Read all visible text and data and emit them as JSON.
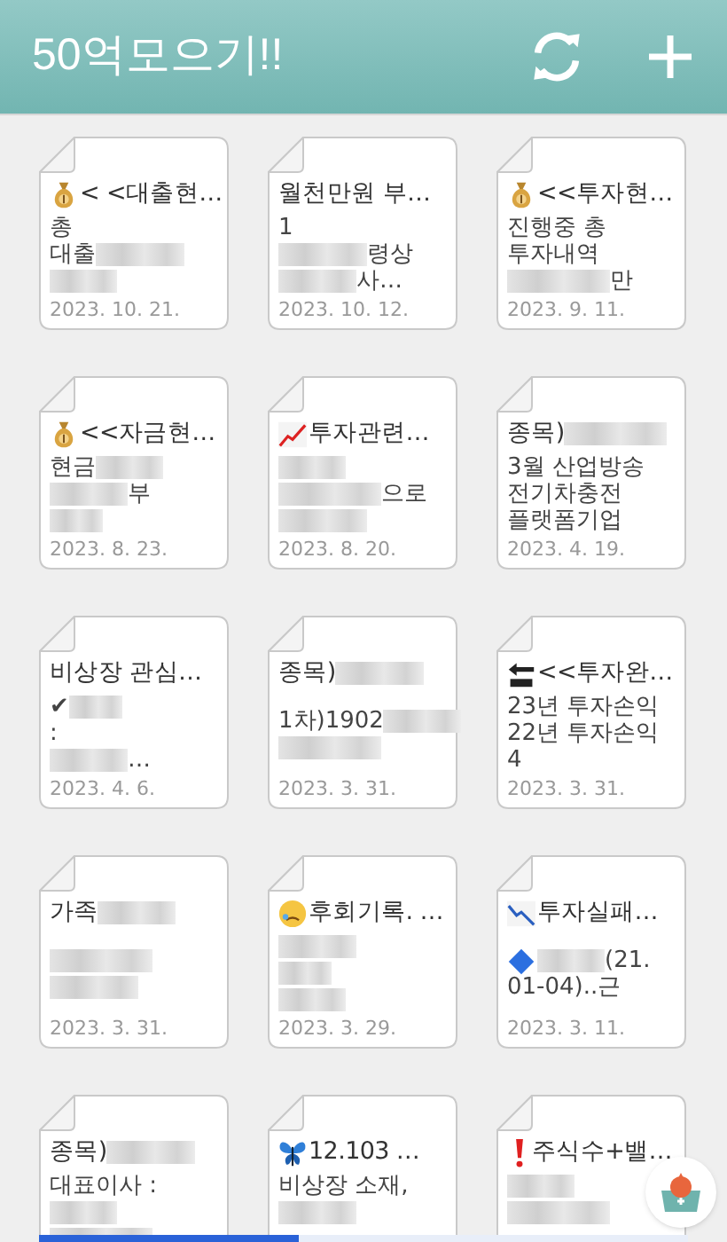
{
  "header": {
    "title": "50억모으기!!"
  },
  "notes": [
    {
      "kind": "moneybag",
      "title": [
        {
          "kind": "text",
          "text": "< <대출현…"
        }
      ],
      "lines": [
        {
          "kind": "line",
          "segments": [
            {
              "kind": "text",
              "text": "총"
            }
          ]
        },
        {
          "kind": "line",
          "segments": [
            {
              "kind": "text",
              "text": "대출"
            },
            {
              "kind": "blur"
            }
          ]
        },
        {
          "kind": "line",
          "segments": [
            {
              "kind": "blur"
            }
          ]
        }
      ],
      "date": "2023. 10. 21."
    },
    {
      "kind": "plain",
      "title": [
        {
          "kind": "text",
          "text": "월천만원 부…"
        }
      ],
      "lines": [
        {
          "kind": "line",
          "segments": [
            {
              "kind": "text",
              "text": "1"
            }
          ]
        },
        {
          "kind": "line",
          "segments": [
            {
              "kind": "blur"
            },
            {
              "kind": "text",
              "text": "령상"
            }
          ]
        },
        {
          "kind": "line",
          "segments": [
            {
              "kind": "blur"
            },
            {
              "kind": "text",
              "text": "사…"
            }
          ]
        }
      ],
      "date": "2023. 10. 12."
    },
    {
      "kind": "moneybag",
      "title": [
        {
          "kind": "text",
          "text": "<<투자현…"
        }
      ],
      "lines": [
        {
          "kind": "line",
          "segments": [
            {
              "kind": "text",
              "text": "진행중 총"
            }
          ]
        },
        {
          "kind": "line",
          "segments": [
            {
              "kind": "text",
              "text": "투자내역"
            }
          ]
        },
        {
          "kind": "line",
          "segments": [
            {
              "kind": "blur"
            },
            {
              "kind": "text",
              "text": "만"
            }
          ]
        }
      ],
      "date": "2023. 9. 11."
    },
    {
      "kind": "moneybag",
      "title": [
        {
          "kind": "text",
          "text": "<<자금현…"
        }
      ],
      "lines": [
        {
          "kind": "line",
          "segments": [
            {
              "kind": "text",
              "text": "현금"
            },
            {
              "kind": "blur"
            }
          ]
        },
        {
          "kind": "line",
          "segments": [
            {
              "kind": "blur"
            },
            {
              "kind": "text",
              "text": "부"
            }
          ]
        },
        {
          "kind": "line",
          "segments": [
            {
              "kind": "blur"
            }
          ]
        }
      ],
      "date": "2023. 8. 23."
    },
    {
      "kind": "chartup",
      "title": [
        {
          "kind": "text",
          "text": "투자관련…"
        }
      ],
      "lines": [
        {
          "kind": "line",
          "segments": [
            {
              "kind": "blur"
            }
          ]
        },
        {
          "kind": "line",
          "segments": [
            {
              "kind": "blur"
            },
            {
              "kind": "text",
              "text": "으로"
            }
          ]
        },
        {
          "kind": "line",
          "segments": [
            {
              "kind": "blur"
            }
          ]
        }
      ],
      "date": "2023. 8. 20."
    },
    {
      "kind": "plain",
      "title": [
        {
          "kind": "text",
          "text": "종목)"
        },
        {
          "kind": "blur"
        }
      ],
      "lines": [
        {
          "kind": "line",
          "segments": [
            {
              "kind": "text",
              "text": "3월 산업방송"
            }
          ]
        },
        {
          "kind": "line",
          "segments": [
            {
              "kind": "text",
              "text": "전기차충전"
            }
          ]
        },
        {
          "kind": "line",
          "segments": [
            {
              "kind": "text",
              "text": "플랫폼기업"
            }
          ]
        }
      ],
      "date": "2023. 4. 19."
    },
    {
      "kind": "plain",
      "title": [
        {
          "kind": "text",
          "text": "비상장 관심…"
        }
      ],
      "lines": [
        {
          "kind": "line",
          "segments": [
            {
              "kind": "text",
              "text": "✔"
            },
            {
              "kind": "blur"
            }
          ]
        },
        {
          "kind": "line",
          "segments": [
            {
              "kind": "text",
              "text": ":"
            }
          ]
        },
        {
          "kind": "line",
          "segments": [
            {
              "kind": "blur"
            },
            {
              "kind": "text",
              "text": "…"
            }
          ]
        }
      ],
      "date": "2023. 4. 6."
    },
    {
      "kind": "plain",
      "title": [
        {
          "kind": "text",
          "text": "종목)"
        },
        {
          "kind": "blur"
        }
      ],
      "lines": [
        {
          "kind": "spacer"
        },
        {
          "kind": "line",
          "segments": [
            {
              "kind": "text",
              "text": "1차)1902"
            },
            {
              "kind": "blur"
            }
          ]
        },
        {
          "kind": "line",
          "segments": [
            {
              "kind": "blur"
            }
          ]
        }
      ],
      "date": "2023. 3. 31."
    },
    {
      "kind": "endarrow",
      "title": [
        {
          "kind": "text",
          "text": "<<투자완…"
        }
      ],
      "lines": [
        {
          "kind": "line",
          "segments": [
            {
              "kind": "text",
              "text": "23년 투자손익"
            }
          ]
        },
        {
          "kind": "line",
          "segments": [
            {
              "kind": "text",
              "text": "22년 투자손익"
            }
          ]
        },
        {
          "kind": "line",
          "segments": [
            {
              "kind": "text",
              "text": "4"
            }
          ]
        }
      ],
      "date": "2023. 3. 31."
    },
    {
      "kind": "plain",
      "title": [
        {
          "kind": "text",
          "text": "가족"
        },
        {
          "kind": "blur"
        }
      ],
      "lines": [
        {
          "kind": "spacer"
        },
        {
          "kind": "line",
          "segments": [
            {
              "kind": "blur"
            }
          ]
        },
        {
          "kind": "line",
          "segments": [
            {
              "kind": "blur"
            }
          ]
        }
      ],
      "date": "2023. 3. 31."
    },
    {
      "kind": "cryingface",
      "title": [
        {
          "kind": "text",
          "text": "후회기록. …"
        }
      ],
      "lines": [
        {
          "kind": "line",
          "segments": [
            {
              "kind": "blur"
            }
          ]
        },
        {
          "kind": "line",
          "segments": [
            {
              "kind": "blur"
            }
          ]
        },
        {
          "kind": "line",
          "segments": [
            {
              "kind": "blur"
            }
          ]
        }
      ],
      "date": "2023. 3. 29."
    },
    {
      "kind": "chartdown",
      "title": [
        {
          "kind": "text",
          "text": "투자실패…"
        }
      ],
      "lines": [
        {
          "kind": "spacer"
        },
        {
          "kind": "line",
          "segments": [
            {
              "kind": "diamond"
            },
            {
              "kind": "blur"
            },
            {
              "kind": "text",
              "text": "(21."
            }
          ]
        },
        {
          "kind": "line",
          "segments": [
            {
              "kind": "text",
              "text": "01-04)..근"
            }
          ]
        }
      ],
      "date": "2023. 3. 11."
    },
    {
      "kind": "plain",
      "title": [
        {
          "kind": "text",
          "text": "종목)"
        },
        {
          "kind": "blur"
        }
      ],
      "lines": [
        {
          "kind": "line",
          "segments": [
            {
              "kind": "text",
              "text": "대표이사 :"
            }
          ]
        },
        {
          "kind": "line",
          "segments": [
            {
              "kind": "blur"
            }
          ]
        },
        {
          "kind": "line",
          "segments": [
            {
              "kind": "blur"
            }
          ]
        }
      ]
    },
    {
      "kind": "butterfly",
      "title": [
        {
          "kind": "text",
          "text": "12.103 …"
        }
      ],
      "lines": [
        {
          "kind": "line",
          "segments": [
            {
              "kind": "text",
              "text": "비상장 소재,"
            }
          ]
        },
        {
          "kind": "line",
          "segments": [
            {
              "kind": "blur"
            }
          ]
        }
      ]
    },
    {
      "kind": "exclamation",
      "title": [
        {
          "kind": "text",
          "text": "주식수+밸…"
        }
      ],
      "lines": [
        {
          "kind": "line",
          "segments": [
            {
              "kind": "blur"
            }
          ]
        },
        {
          "kind": "line",
          "segments": [
            {
              "kind": "blur"
            }
          ]
        }
      ]
    }
  ]
}
